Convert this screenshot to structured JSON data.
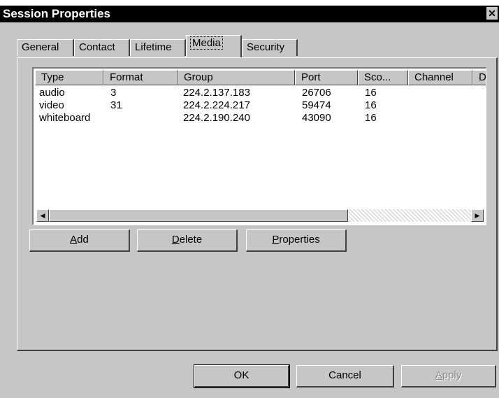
{
  "window": {
    "title": "Session Properties",
    "close_glyph": "✕"
  },
  "tabs": [
    {
      "label": "General"
    },
    {
      "label": "Contact"
    },
    {
      "label": "Lifetime"
    },
    {
      "label": "Media",
      "active": true
    },
    {
      "label": "Security"
    }
  ],
  "media_list": {
    "columns": [
      "Type",
      "Format",
      "Group",
      "Port",
      "Sco...",
      "Channel",
      "D"
    ],
    "rows": [
      {
        "type": "audio",
        "format": "3",
        "group": "224.2.137.183",
        "port": "26706",
        "scope": "16",
        "channel": ""
      },
      {
        "type": "video",
        "format": "31",
        "group": "224.2.224.217",
        "port": "59474",
        "scope": "16",
        "channel": ""
      },
      {
        "type": "whiteboard",
        "format": "",
        "group": "224.2.190.240",
        "port": "43090",
        "scope": "16",
        "channel": ""
      }
    ]
  },
  "scroll": {
    "left_glyph": "◀",
    "right_glyph": "▶"
  },
  "media_buttons": {
    "add": {
      "label": "Add",
      "mnemonic": "A"
    },
    "delete": {
      "label": "Delete",
      "mnemonic": "D"
    },
    "properties": {
      "label": "Properties",
      "mnemonic": "P"
    }
  },
  "dialog_buttons": {
    "ok": "OK",
    "cancel": "Cancel",
    "apply": {
      "label": "Apply",
      "mnemonic": "A",
      "enabled": false
    }
  }
}
